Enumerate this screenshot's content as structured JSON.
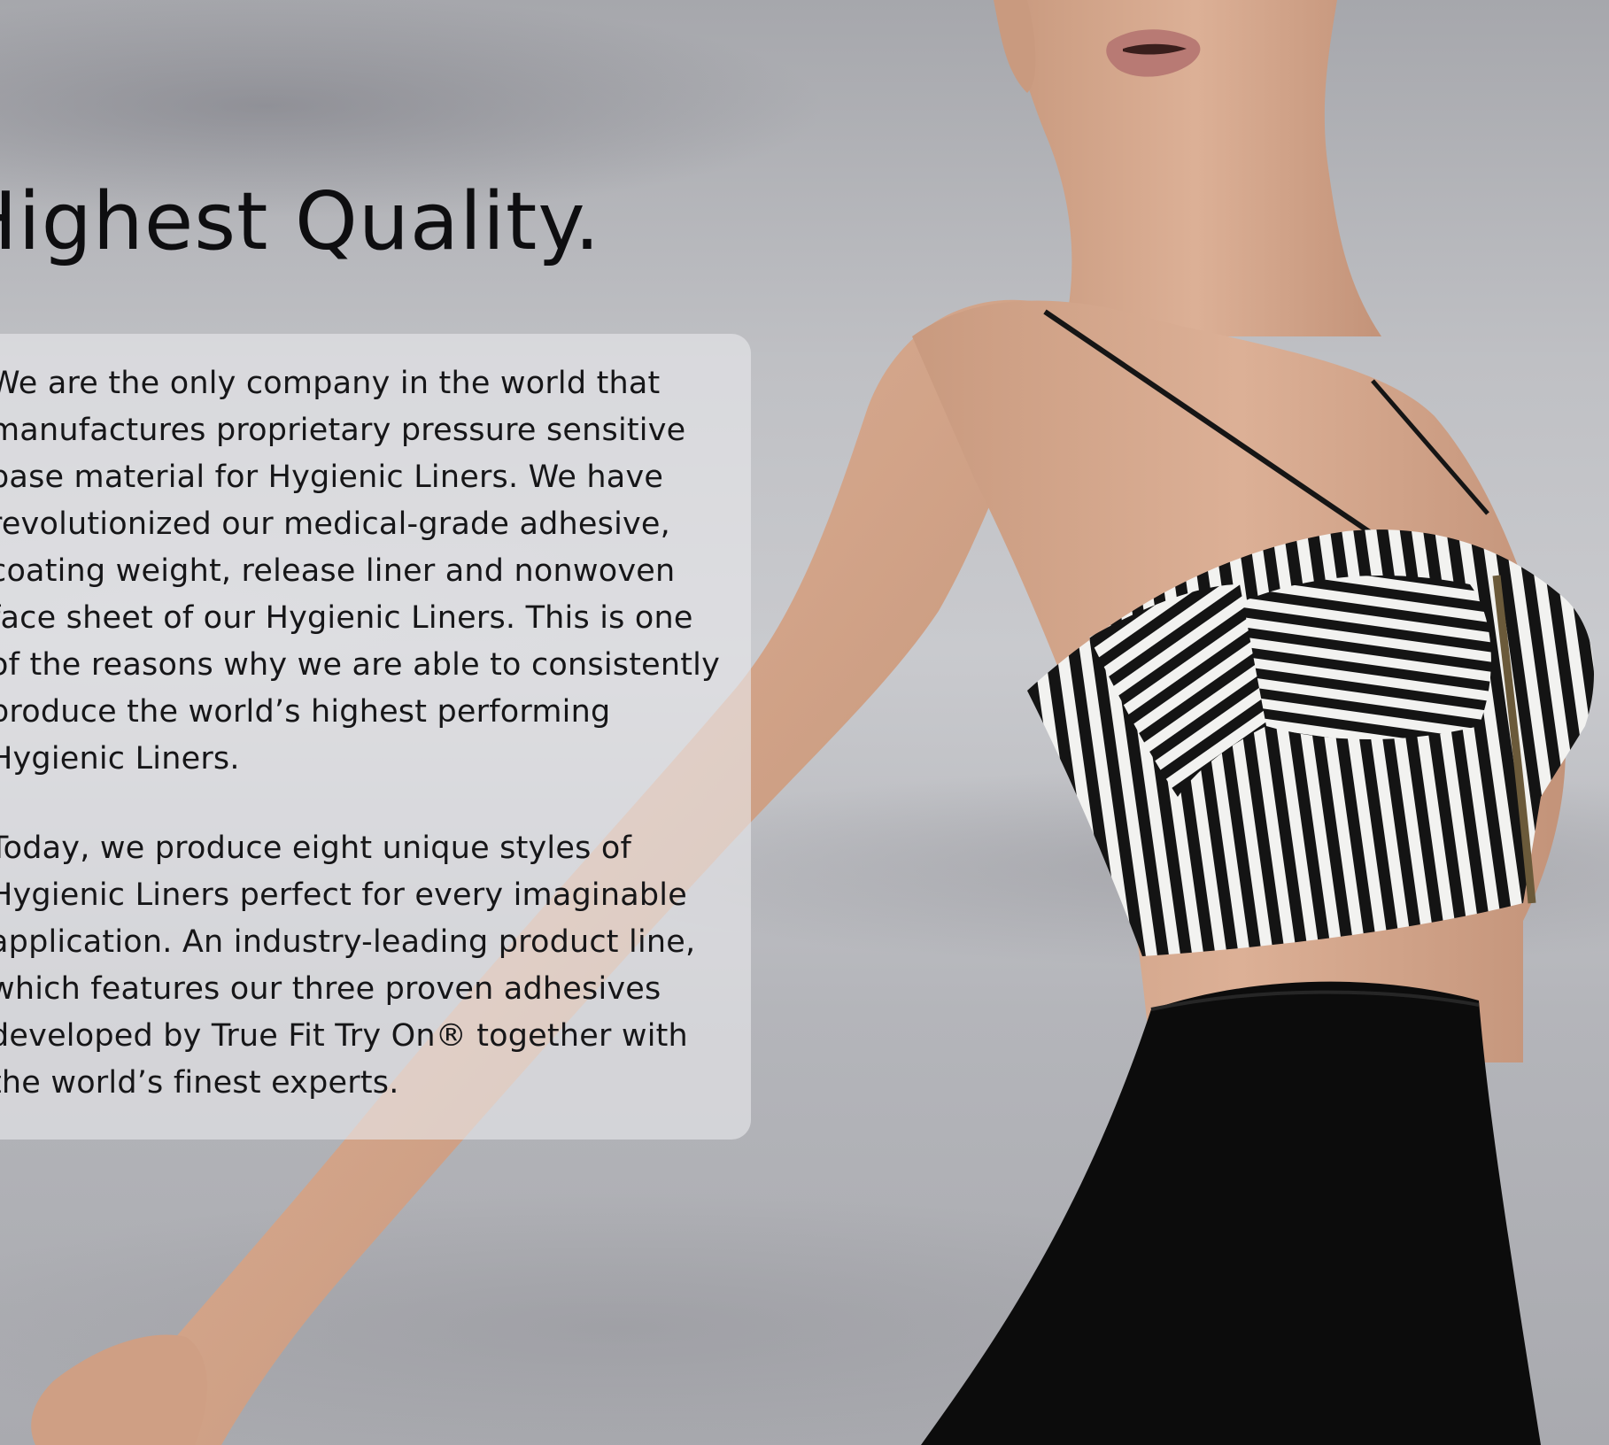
{
  "hero": {
    "headline": "Highest Quality.",
    "paragraphs": [
      "We are the only company in the world that\nmanufactures proprietary pressure sensitive\nbase material for Hygienic Liners. We have\nrevolutionized our medical-grade adhesive,\ncoating weight, release liner and nonwoven\nface sheet of our Hygienic Liners. This is one\nof the reasons why we are able to consistently\nproduce the world’s highest performing\nHygienic Liners.",
      "Today, we produce eight unique styles of\nHygienic Liners perfect for every imaginable\napplication. An industry-leading product line,\nwhich features our three proven adhesives\ndeveloped by True Fit Try On® together with\nthe world’s finest experts."
    ]
  },
  "colors": {
    "sky": "#bfc0c4",
    "skin": "#d4a58a",
    "stripe_dark": "#141414",
    "stripe_light": "#f2f2f0",
    "text": "#161618",
    "card": "rgba(232,232,236,0.62)"
  }
}
